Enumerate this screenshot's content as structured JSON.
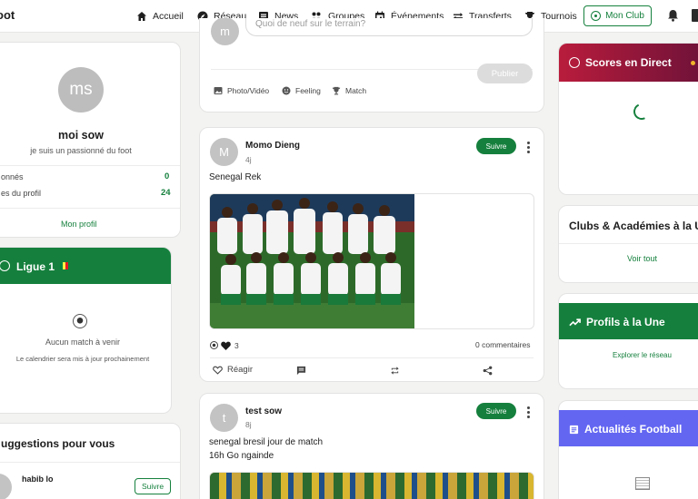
{
  "nav": {
    "brand": "oot",
    "items": [
      {
        "label": "Accueil",
        "icon": "home-icon"
      },
      {
        "label": "Réseau",
        "icon": "compass-icon"
      },
      {
        "label": "News",
        "icon": "news-icon"
      },
      {
        "label": "Groupes",
        "icon": "groups-icon"
      },
      {
        "label": "Événements",
        "icon": "calendar-icon"
      },
      {
        "label": "Transferts",
        "icon": "transfer-icon"
      },
      {
        "label": "Tournois",
        "icon": "trophy-icon"
      }
    ],
    "mon_club": "Mon Club"
  },
  "profile": {
    "initials": "ms",
    "name": "moi sow",
    "bio": "je suis un passionné du foot",
    "stats": [
      {
        "label": "onnés",
        "value": "0"
      },
      {
        "label": "es du profil",
        "value": "24"
      }
    ],
    "link": "Mon profil"
  },
  "league": {
    "title": "Ligue 1",
    "empty_title": "Aucun match à venir",
    "empty_sub": "Le calendrier sera mis à jour prochainement"
  },
  "suggestions": {
    "title": "uggestions pour vous",
    "user": "habib lo",
    "follow": "Suivre"
  },
  "composer": {
    "avatar": "m",
    "placeholder": "Quoi de neuf sur le terrain?",
    "actions": [
      "Photo/Vidéo",
      "Feeling",
      "Match"
    ],
    "publish": "Publier"
  },
  "posts": [
    {
      "avatar": "M",
      "author": "Momo Dieng",
      "ago": "4j",
      "follow": "Suivre",
      "text": [
        "Senegal Rek"
      ],
      "reaction_count": "3",
      "comments": "0 commentaires",
      "actions": [
        "Réagir"
      ]
    },
    {
      "avatar": "t",
      "author": "test sow",
      "ago": "8j",
      "follow": "Suivre",
      "text": [
        "senegal bresil jour de match",
        "16h Go ngainde"
      ]
    }
  ],
  "right": {
    "live_title": "Scores en Direct",
    "clubs_title": "Clubs & Académies à la U",
    "clubs_link": "Voir tout",
    "profiles_title": "Profils à la Une",
    "profiles_link": "Explorer le réseau",
    "news_title": "Actualités Football"
  },
  "colors": {
    "accent": "#15803d",
    "live_grad_start": "#b91c3c",
    "live_grad_end": "#6b1138",
    "news_grad": "#6366f1"
  }
}
